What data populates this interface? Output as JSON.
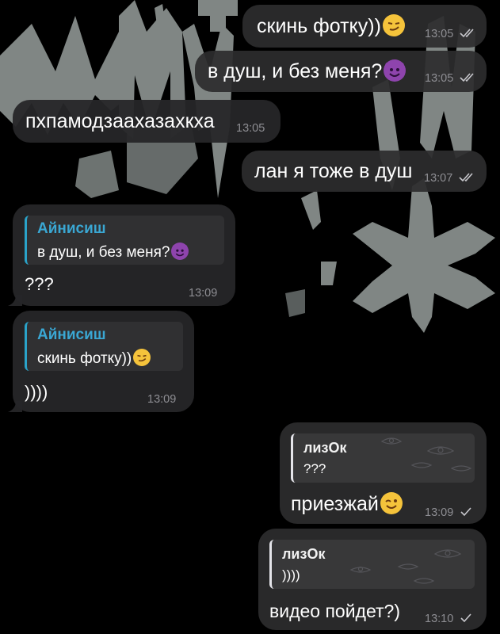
{
  "messages": [
    {
      "text": "скинь фотку))",
      "emoji": "smirk-emoji",
      "time": "13:05",
      "status": "read"
    },
    {
      "text": "в душ, и без меня?",
      "emoji": "smiling-devil-emoji",
      "time": "13:05",
      "status": "read"
    },
    {
      "text": "пхпамодзаахазахкха",
      "time": "13:05"
    },
    {
      "text": "лан я тоже в душ",
      "time": "13:07",
      "status": "read"
    },
    {
      "reply_name": "Айнисиш",
      "reply_text": "в душ, и без меня?",
      "reply_emoji": "smiling-devil-emoji",
      "text": "???",
      "time": "13:09"
    },
    {
      "reply_name": "Айнисиш",
      "reply_text": "скинь фотку))",
      "reply_emoji": "smirk-emoji",
      "text": "))))",
      "time": "13:09"
    },
    {
      "reply_name": "лизОк",
      "reply_text": "???",
      "text": "приезжай",
      "emoji": "winking-face-emoji",
      "time": "13:09",
      "status": "sent"
    },
    {
      "reply_name": "лизОк",
      "reply_text": "))))",
      "text": "видео пойдет?)",
      "time": "13:10",
      "status": "sent"
    }
  ],
  "colors": {
    "background": "#000000",
    "bubble": "#2c2c2e",
    "reply_accent_incoming": "#2aa3c9",
    "reply_accent_outgoing": "#e5e5ea",
    "time": "#8e8e93"
  }
}
